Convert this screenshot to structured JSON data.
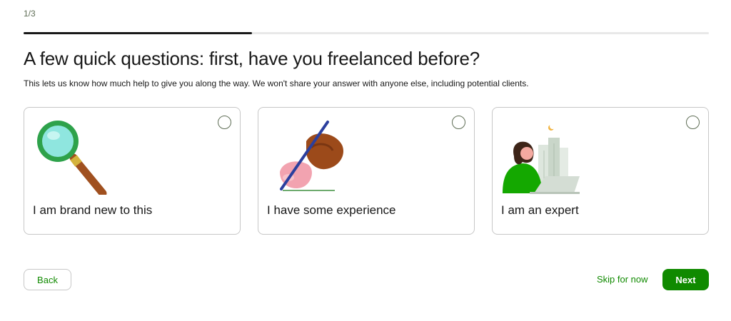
{
  "step_indicator": "1/3",
  "progress": {
    "fraction": 0.333,
    "fill_color": "#181818",
    "track_color": "#e8e8e8"
  },
  "heading": "A few quick questions: first, have you freelanced before?",
  "description": "This lets us know how much help to give you along the way. We won't share your answer with anyone else, including potential clients.",
  "options": [
    {
      "label": "I am brand new to this",
      "icon": "magnifying-glass-icon",
      "selected": false
    },
    {
      "label": "I have some experience",
      "icon": "hand-writing-icon",
      "selected": false
    },
    {
      "label": "I am an expert",
      "icon": "person-laptop-icon",
      "selected": false
    }
  ],
  "footer": {
    "back_label": "Back",
    "skip_label": "Skip for now",
    "next_label": "Next"
  },
  "colors": {
    "accent_green": "#108a00",
    "text": "#181818",
    "border": "#c7c7c7"
  }
}
